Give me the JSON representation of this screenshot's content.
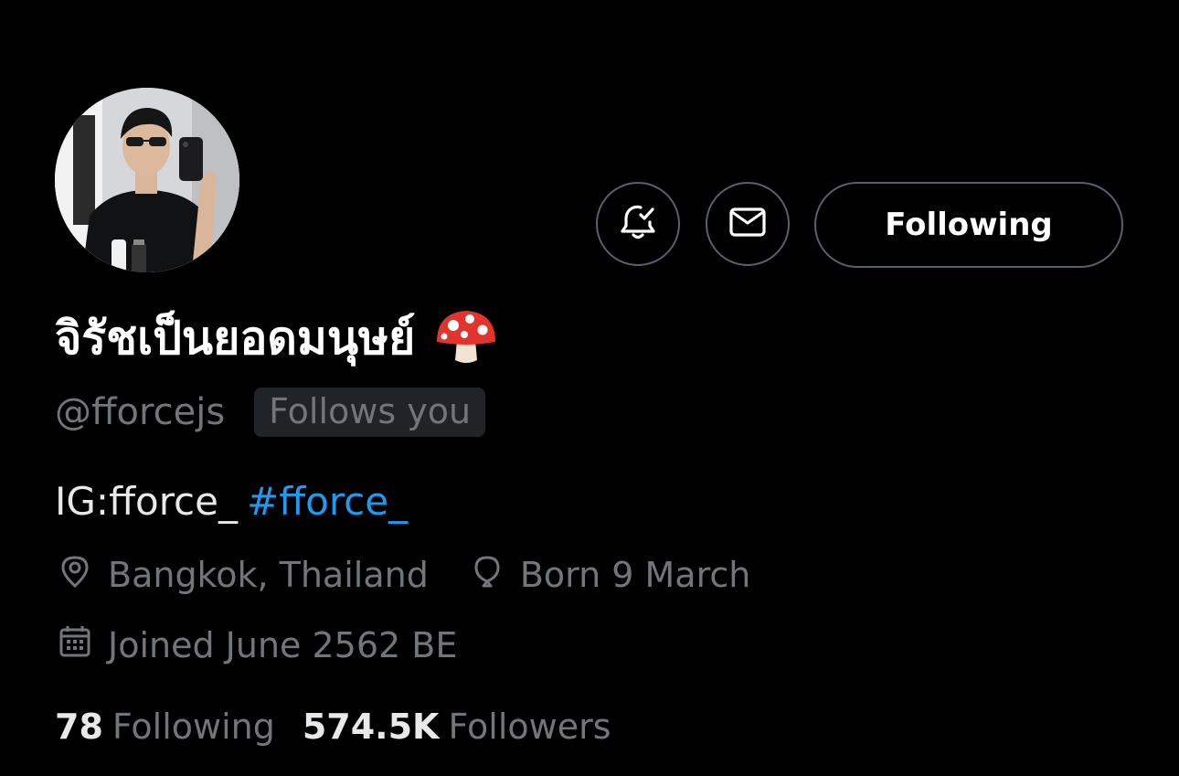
{
  "profile": {
    "display_name": "จิรัชเป็นยอดมนุษย์",
    "name_emoji_icon": "mushroom-icon",
    "handle": "@fforcejs",
    "follows_you_label": "Follows you",
    "bio_text": "IG:fforce_",
    "bio_hashtag": "#fforce_",
    "location": "Bangkok, Thailand",
    "birthday": "Born 9 March",
    "joined": "Joined June 2562 BE"
  },
  "actions": {
    "notify_icon": "bell-check-icon",
    "message_icon": "envelope-icon",
    "following_label": "Following"
  },
  "stats": {
    "following_count": "78",
    "following_label": "Following",
    "followers_count": "574.5K",
    "followers_label": "Followers"
  },
  "colors": {
    "background": "#000000",
    "primary_text": "#e7e9ea",
    "secondary_text": "#71767b",
    "link": "#1d9bf0",
    "border": "#536471",
    "badge_bg": "#202327"
  }
}
